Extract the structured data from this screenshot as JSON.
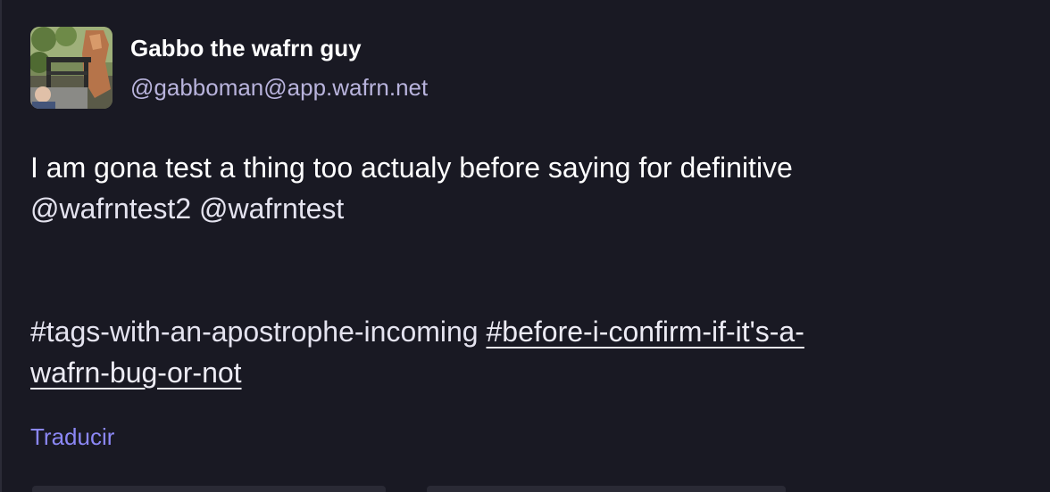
{
  "post": {
    "author": {
      "display_name": "Gabbo the wafrn guy",
      "handle": "@gabboman@app.wafrn.net"
    },
    "content": {
      "text": "I am gona test a thing too actualy before saying for definitive",
      "mentions": [
        "@wafrntest2",
        "@wafrntest"
      ],
      "tag_plain": "#tags-with-an-apostrophe-incoming",
      "tag_link_part1": "#before-i-confirm-if-it's-a-",
      "tag_link_part2": "wafrn-bug-or-not"
    },
    "translate_label": "Traducir"
  },
  "colors": {
    "background": "#191923",
    "text": "#ffffff",
    "handle": "#b8b3dc",
    "link_accent": "#8b87f5"
  }
}
